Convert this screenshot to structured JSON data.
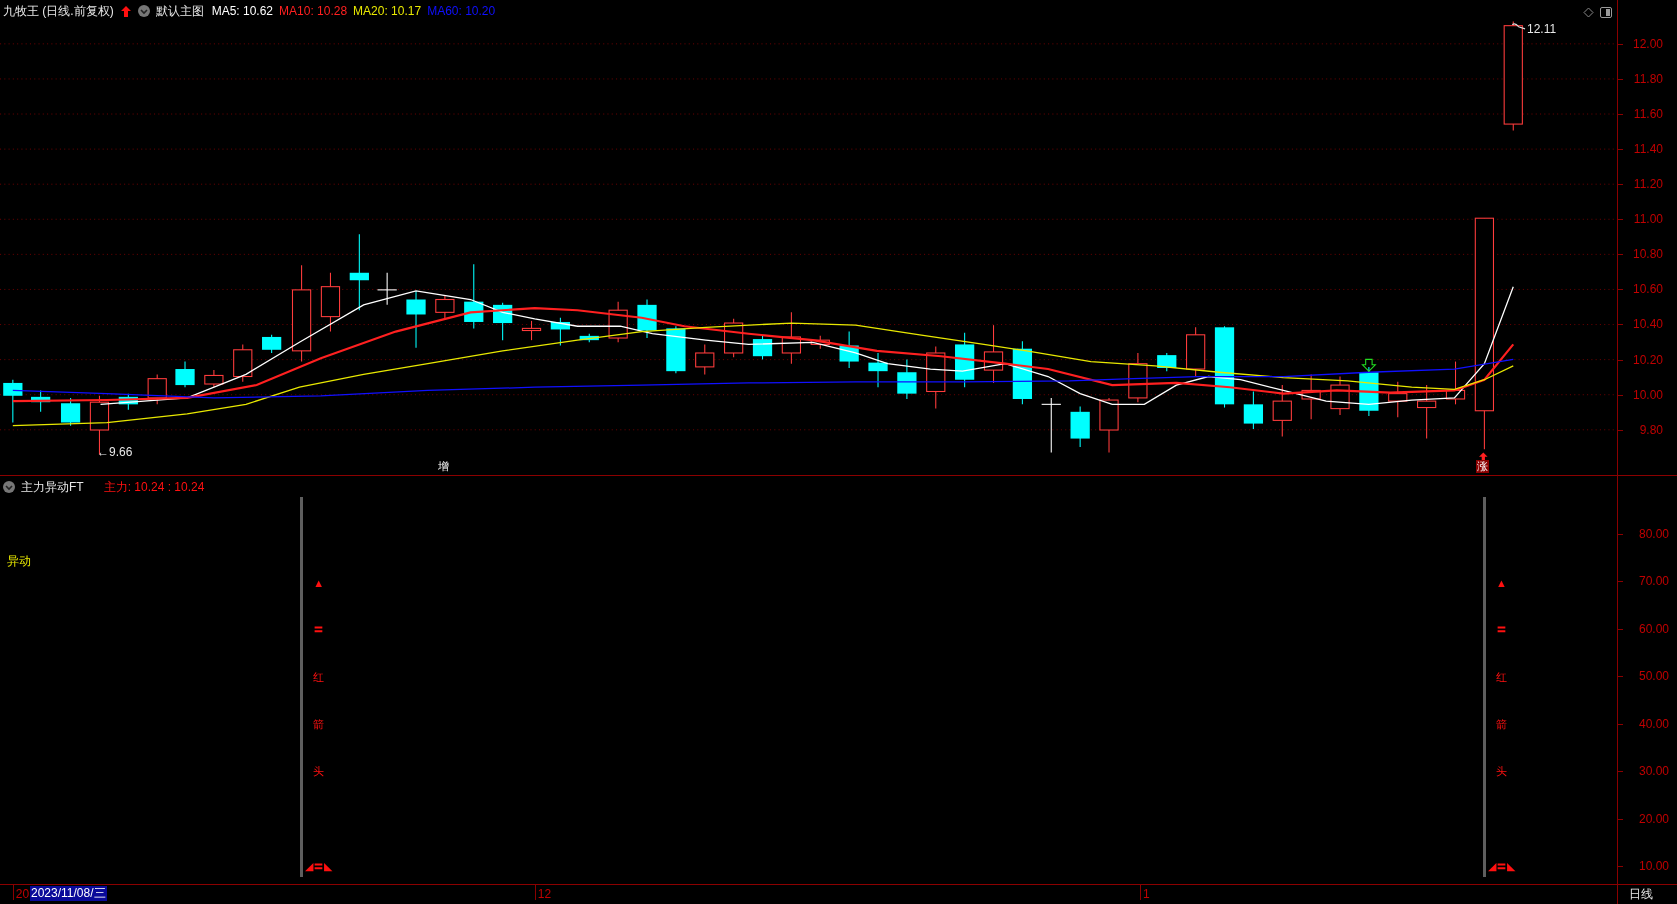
{
  "header": {
    "title": "九牧王 (日线.前复权)",
    "template": "默认主图",
    "ma": [
      {
        "label": "MA5: 10.62",
        "color": "#ffffff"
      },
      {
        "label": "MA10: 10.28",
        "color": "#ff2020"
      },
      {
        "label": "MA20: 10.17",
        "color": "#e8e800"
      },
      {
        "label": "MA60: 10.20",
        "color": "#1010ff"
      }
    ]
  },
  "price_axis": [
    "12.00",
    "11.80",
    "11.60",
    "11.40",
    "11.20",
    "11.00",
    "10.80",
    "10.60",
    "10.40",
    "10.20",
    "10.00",
    "9.80"
  ],
  "price_annotations": [
    {
      "kind": "price",
      "text": "12.11"
    },
    {
      "kind": "price",
      "text": "←9.66"
    },
    {
      "kind": "tag",
      "text": "增"
    },
    {
      "kind": "tag",
      "text": "涨"
    }
  ],
  "indicator": {
    "title": "主力异动FT",
    "reading": "主力: 10.24 : 10.24",
    "label": "异动",
    "signals": [
      {
        "marks": [
          "▲",
          "〓",
          "红",
          "箭",
          "头",
          "◢〓◣"
        ]
      },
      {
        "marks": [
          "▲",
          "〓",
          "红",
          "箭",
          "头",
          "◢〓◣"
        ]
      }
    ]
  },
  "indicator_axis": [
    "80.00",
    "70.00",
    "60.00",
    "50.00",
    "40.00",
    "30.00",
    "20.00",
    "10.00"
  ],
  "time_axis": {
    "labels": [
      "20",
      "12",
      "1"
    ],
    "cursor": "2023/11/08/三",
    "period": "日线"
  }
}
